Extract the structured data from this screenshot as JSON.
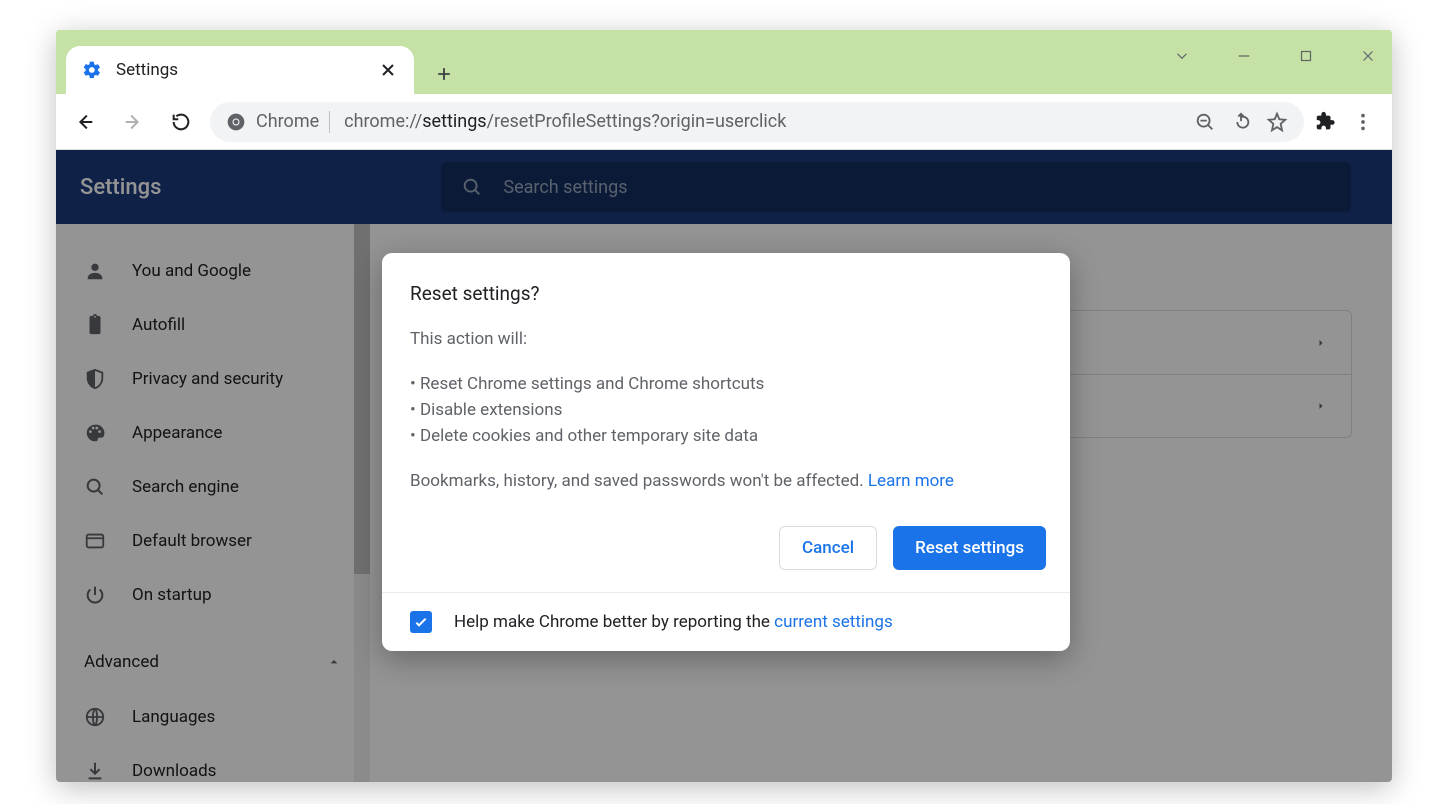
{
  "tab": {
    "title": "Settings"
  },
  "omnibox": {
    "chip": "Chrome",
    "url_prefix": "chrome://",
    "url_bold": "settings",
    "url_rest": "/resetProfileSettings?origin=userclick"
  },
  "settings_header": {
    "title": "Settings",
    "search_placeholder": "Search settings"
  },
  "sidebar": {
    "items": [
      {
        "label": "You and Google",
        "icon": "person-icon"
      },
      {
        "label": "Autofill",
        "icon": "clipboard-icon"
      },
      {
        "label": "Privacy and security",
        "icon": "shield-icon"
      },
      {
        "label": "Appearance",
        "icon": "palette-icon"
      },
      {
        "label": "Search engine",
        "icon": "search-icon"
      },
      {
        "label": "Default browser",
        "icon": "browser-icon"
      },
      {
        "label": "On startup",
        "icon": "power-icon"
      }
    ],
    "advanced_label": "Advanced",
    "advanced_children": [
      {
        "label": "Languages",
        "icon": "globe-icon"
      },
      {
        "label": "Downloads",
        "icon": "download-icon"
      }
    ]
  },
  "dialog": {
    "title": "Reset settings?",
    "lead": "This action will:",
    "bullets": [
      "Reset Chrome settings and Chrome shortcuts",
      "Disable extensions",
      "Delete cookies and other temporary site data"
    ],
    "note_text": "Bookmarks, history, and saved passwords won't be affected. ",
    "note_link": "Learn more",
    "cancel": "Cancel",
    "confirm": "Reset settings",
    "footer_text": "Help make Chrome better by reporting the ",
    "footer_link": "current settings",
    "footer_checked": true
  }
}
